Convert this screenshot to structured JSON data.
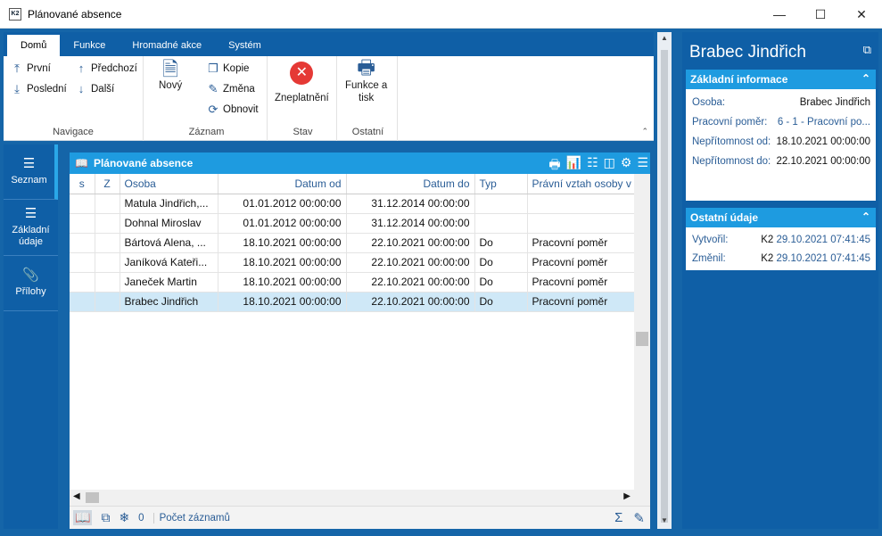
{
  "window": {
    "title": "Plánované absence",
    "icon_text": "K2"
  },
  "ribbon": {
    "tabs": [
      "Domů",
      "Funkce",
      "Hromadné akce",
      "Systém"
    ],
    "nav": {
      "first": "První",
      "last": "Poslední",
      "prev": "Předchozí",
      "next": "Další",
      "group": "Navigace"
    },
    "record": {
      "new": "Nový",
      "copy": "Kopie",
      "change": "Změna",
      "refresh": "Obnovit",
      "group": "Záznam"
    },
    "state": {
      "invalidate": "Zneplatnění",
      "group": "Stav"
    },
    "other": {
      "print_line1": "Funkce a",
      "print_line2": "tisk",
      "group": "Ostatní"
    }
  },
  "leftnav": [
    {
      "label": "Seznam"
    },
    {
      "label": "Základní\núdaje"
    },
    {
      "label": "Přílohy"
    }
  ],
  "table": {
    "title": "Plánované absence",
    "columns": [
      "s",
      "Z",
      "Osoba",
      "Datum od",
      "Datum do",
      "Typ",
      "Právní vztah osoby v d"
    ],
    "rows": [
      [
        "",
        "",
        "Matula Jindřich,...",
        "01.01.2012 00:00:00",
        "31.12.2014 00:00:00",
        "",
        ""
      ],
      [
        "",
        "",
        "Dohnal Miroslav",
        "01.01.2012 00:00:00",
        "31.12.2014 00:00:00",
        "",
        ""
      ],
      [
        "",
        "",
        "Bártová Alena, ...",
        "18.10.2021 00:00:00",
        "22.10.2021 00:00:00",
        "Do",
        "Pracovní poměr"
      ],
      [
        "",
        "",
        "Janíková Kateři...",
        "18.10.2021 00:00:00",
        "22.10.2021 00:00:00",
        "Do",
        "Pracovní poměr"
      ],
      [
        "",
        "",
        "Janeček Martin",
        "18.10.2021 00:00:00",
        "22.10.2021 00:00:00",
        "Do",
        "Pracovní poměr"
      ],
      [
        "",
        "",
        "Brabec Jindřich",
        "18.10.2021 00:00:00",
        "22.10.2021 00:00:00",
        "Do",
        "Pracovní poměr"
      ]
    ],
    "selected_row": 5,
    "footer": {
      "filter_count": "0",
      "records_label": "Počet záznamů"
    }
  },
  "right": {
    "title": "Brabec Jindřich",
    "basic": {
      "header": "Základní informace",
      "osoba_k": "Osoba:",
      "osoba_v": "Brabec Jindřich",
      "pp_k": "Pracovní poměr:",
      "pp_v": "6 - 1 - Pracovní po...",
      "od_k": "Nepřítomnost od:",
      "od_v": "18.10.2021 00:00:00",
      "do_k": "Nepřítomnost do:",
      "do_v": "22.10.2021 00:00:00"
    },
    "other": {
      "header": "Ostatní údaje",
      "created_k": "Vytvořil:",
      "created_user": "K2",
      "created_date": "29.10.2021 07:41:45",
      "changed_k": "Změnil:",
      "changed_user": "K2",
      "changed_date": "29.10.2021 07:41:45"
    }
  },
  "colors": {
    "frame": "#1565a8",
    "accent": "#1e9be0",
    "selected_row": "#cfe8f7",
    "danger": "#e53935"
  }
}
